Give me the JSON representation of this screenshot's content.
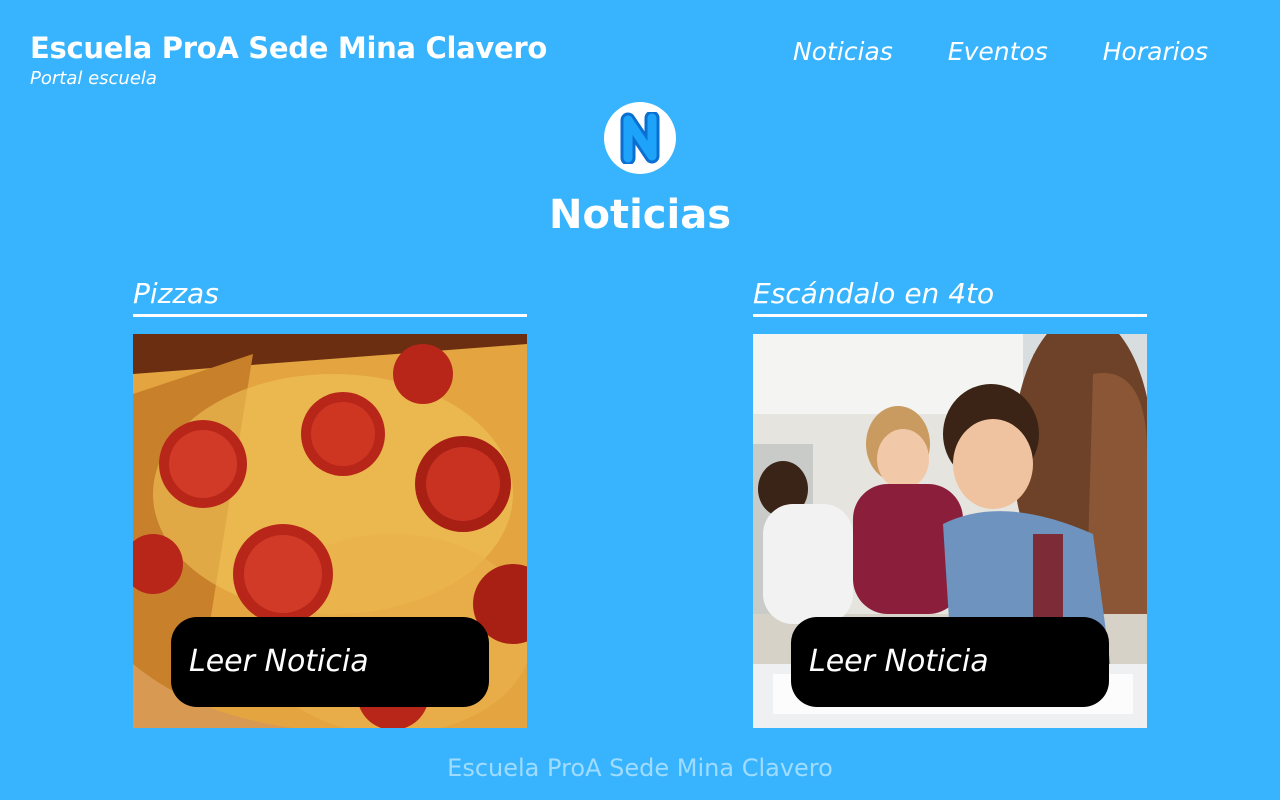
{
  "header": {
    "title": "Escuela ProA Sede Mina Clavero",
    "subtitle": "Portal escuela"
  },
  "nav": {
    "items": [
      "Noticias",
      "Eventos",
      "Horarios"
    ]
  },
  "section": {
    "logo_letter": "N",
    "title": "Noticias"
  },
  "cards": [
    {
      "title": "Pizzas",
      "image": "pepperoni-pizza-photo",
      "button_label": "Leer Noticia"
    },
    {
      "title": "Escándalo en 4to",
      "image": "students-studying-photo",
      "button_label": "Leer Noticia"
    }
  ],
  "footer": {
    "text": "Escuela ProA Sede Mina Clavero"
  },
  "colors": {
    "background": "#38b4fe",
    "button": "#000000",
    "footer_text": "#9fdcff"
  }
}
